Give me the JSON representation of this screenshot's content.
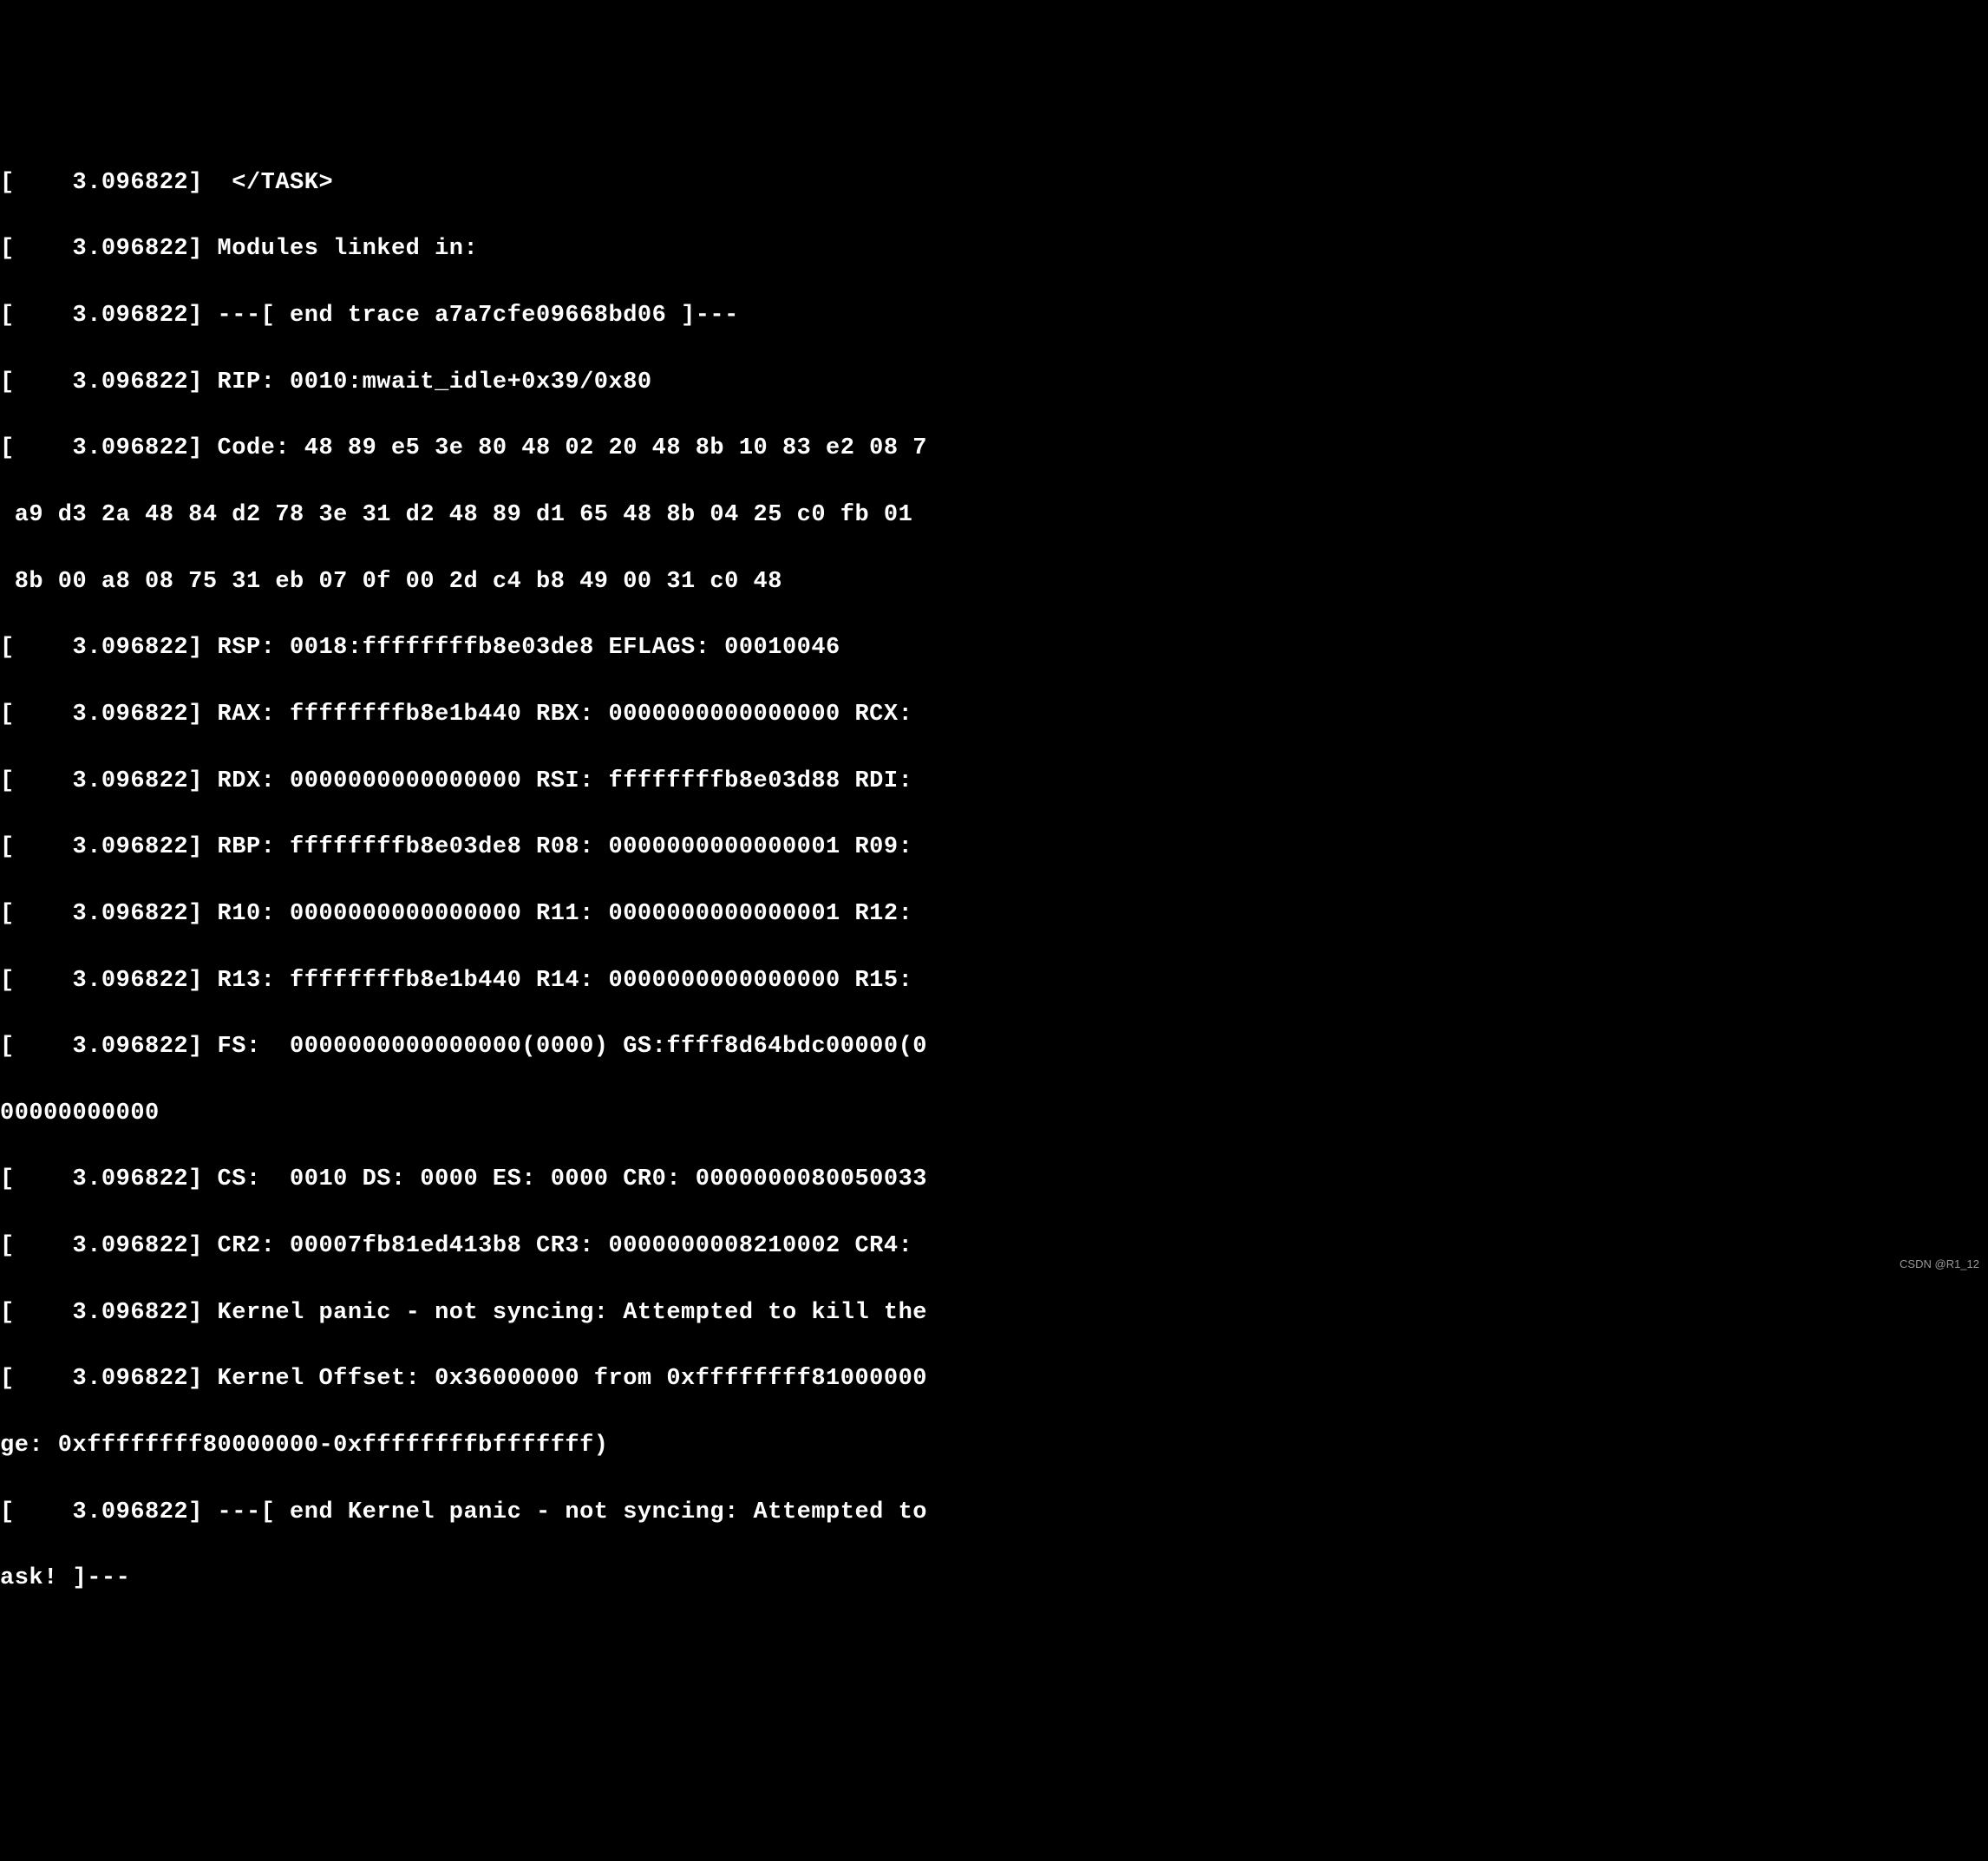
{
  "terminal": {
    "lines": [
      "[    3.096822]  </TASK>",
      "[    3.096822] Modules linked in:",
      "[    3.096822] ---[ end trace a7a7cfe09668bd06 ]---",
      "[    3.096822] RIP: 0010:mwait_idle+0x39/0x80",
      "[    3.096822] Code: 48 89 e5 3e 80 48 02 20 48 8b 10 83 e2 08 7",
      " a9 d3 2a 48 84 d2 78 3e 31 d2 48 89 d1 65 48 8b 04 25 c0 fb 01",
      " 8b 00 a8 08 75 31 eb 07 0f 00 2d c4 b8 49 00 31 c0 48",
      "[    3.096822] RSP: 0018:ffffffffb8e03de8 EFLAGS: 00010046",
      "[    3.096822] RAX: ffffffffb8e1b440 RBX: 0000000000000000 RCX:",
      "[    3.096822] RDX: 0000000000000000 RSI: ffffffffb8e03d88 RDI:",
      "[    3.096822] RBP: ffffffffb8e03de8 R08: 0000000000000001 R09:",
      "[    3.096822] R10: 0000000000000000 R11: 0000000000000001 R12:",
      "[    3.096822] R13: ffffffffb8e1b440 R14: 0000000000000000 R15:",
      "[    3.096822] FS:  0000000000000000(0000) GS:ffff8d64bdc00000(0",
      "00000000000",
      "[    3.096822] CS:  0010 DS: 0000 ES: 0000 CR0: 0000000080050033",
      "[    3.096822] CR2: 00007fb81ed413b8 CR3: 0000000008210002 CR4:",
      "[    3.096822] Kernel panic - not syncing: Attempted to kill the",
      "[    3.096822] Kernel Offset: 0x36000000 from 0xffffffff81000000",
      "ge: 0xffffffff80000000-0xffffffffbfffffff)",
      "[    3.096822] ---[ end Kernel panic - not syncing: Attempted to",
      "ask! ]---"
    ]
  },
  "watermark": "CSDN @R1_12"
}
